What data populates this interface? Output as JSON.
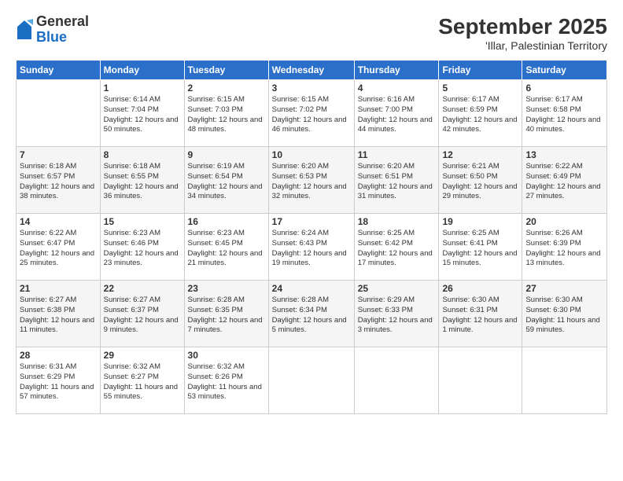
{
  "header": {
    "logo": {
      "general": "General",
      "blue": "Blue"
    },
    "title": "September 2025",
    "subtitle": "'Illar, Palestinian Territory"
  },
  "calendar": {
    "weekdays": [
      "Sunday",
      "Monday",
      "Tuesday",
      "Wednesday",
      "Thursday",
      "Friday",
      "Saturday"
    ],
    "weeks": [
      [
        {
          "day": "",
          "detail": ""
        },
        {
          "day": "1",
          "detail": "Sunrise: 6:14 AM\nSunset: 7:04 PM\nDaylight: 12 hours\nand 50 minutes."
        },
        {
          "day": "2",
          "detail": "Sunrise: 6:15 AM\nSunset: 7:03 PM\nDaylight: 12 hours\nand 48 minutes."
        },
        {
          "day": "3",
          "detail": "Sunrise: 6:15 AM\nSunset: 7:02 PM\nDaylight: 12 hours\nand 46 minutes."
        },
        {
          "day": "4",
          "detail": "Sunrise: 6:16 AM\nSunset: 7:00 PM\nDaylight: 12 hours\nand 44 minutes."
        },
        {
          "day": "5",
          "detail": "Sunrise: 6:17 AM\nSunset: 6:59 PM\nDaylight: 12 hours\nand 42 minutes."
        },
        {
          "day": "6",
          "detail": "Sunrise: 6:17 AM\nSunset: 6:58 PM\nDaylight: 12 hours\nand 40 minutes."
        }
      ],
      [
        {
          "day": "7",
          "detail": "Sunrise: 6:18 AM\nSunset: 6:57 PM\nDaylight: 12 hours\nand 38 minutes."
        },
        {
          "day": "8",
          "detail": "Sunrise: 6:18 AM\nSunset: 6:55 PM\nDaylight: 12 hours\nand 36 minutes."
        },
        {
          "day": "9",
          "detail": "Sunrise: 6:19 AM\nSunset: 6:54 PM\nDaylight: 12 hours\nand 34 minutes."
        },
        {
          "day": "10",
          "detail": "Sunrise: 6:20 AM\nSunset: 6:53 PM\nDaylight: 12 hours\nand 32 minutes."
        },
        {
          "day": "11",
          "detail": "Sunrise: 6:20 AM\nSunset: 6:51 PM\nDaylight: 12 hours\nand 31 minutes."
        },
        {
          "day": "12",
          "detail": "Sunrise: 6:21 AM\nSunset: 6:50 PM\nDaylight: 12 hours\nand 29 minutes."
        },
        {
          "day": "13",
          "detail": "Sunrise: 6:22 AM\nSunset: 6:49 PM\nDaylight: 12 hours\nand 27 minutes."
        }
      ],
      [
        {
          "day": "14",
          "detail": "Sunrise: 6:22 AM\nSunset: 6:47 PM\nDaylight: 12 hours\nand 25 minutes."
        },
        {
          "day": "15",
          "detail": "Sunrise: 6:23 AM\nSunset: 6:46 PM\nDaylight: 12 hours\nand 23 minutes."
        },
        {
          "day": "16",
          "detail": "Sunrise: 6:23 AM\nSunset: 6:45 PM\nDaylight: 12 hours\nand 21 minutes."
        },
        {
          "day": "17",
          "detail": "Sunrise: 6:24 AM\nSunset: 6:43 PM\nDaylight: 12 hours\nand 19 minutes."
        },
        {
          "day": "18",
          "detail": "Sunrise: 6:25 AM\nSunset: 6:42 PM\nDaylight: 12 hours\nand 17 minutes."
        },
        {
          "day": "19",
          "detail": "Sunrise: 6:25 AM\nSunset: 6:41 PM\nDaylight: 12 hours\nand 15 minutes."
        },
        {
          "day": "20",
          "detail": "Sunrise: 6:26 AM\nSunset: 6:39 PM\nDaylight: 12 hours\nand 13 minutes."
        }
      ],
      [
        {
          "day": "21",
          "detail": "Sunrise: 6:27 AM\nSunset: 6:38 PM\nDaylight: 12 hours\nand 11 minutes."
        },
        {
          "day": "22",
          "detail": "Sunrise: 6:27 AM\nSunset: 6:37 PM\nDaylight: 12 hours\nand 9 minutes."
        },
        {
          "day": "23",
          "detail": "Sunrise: 6:28 AM\nSunset: 6:35 PM\nDaylight: 12 hours\nand 7 minutes."
        },
        {
          "day": "24",
          "detail": "Sunrise: 6:28 AM\nSunset: 6:34 PM\nDaylight: 12 hours\nand 5 minutes."
        },
        {
          "day": "25",
          "detail": "Sunrise: 6:29 AM\nSunset: 6:33 PM\nDaylight: 12 hours\nand 3 minutes."
        },
        {
          "day": "26",
          "detail": "Sunrise: 6:30 AM\nSunset: 6:31 PM\nDaylight: 12 hours\nand 1 minute."
        },
        {
          "day": "27",
          "detail": "Sunrise: 6:30 AM\nSunset: 6:30 PM\nDaylight: 11 hours\nand 59 minutes."
        }
      ],
      [
        {
          "day": "28",
          "detail": "Sunrise: 6:31 AM\nSunset: 6:29 PM\nDaylight: 11 hours\nand 57 minutes."
        },
        {
          "day": "29",
          "detail": "Sunrise: 6:32 AM\nSunset: 6:27 PM\nDaylight: 11 hours\nand 55 minutes."
        },
        {
          "day": "30",
          "detail": "Sunrise: 6:32 AM\nSunset: 6:26 PM\nDaylight: 11 hours\nand 53 minutes."
        },
        {
          "day": "",
          "detail": ""
        },
        {
          "day": "",
          "detail": ""
        },
        {
          "day": "",
          "detail": ""
        },
        {
          "day": "",
          "detail": ""
        }
      ]
    ]
  }
}
